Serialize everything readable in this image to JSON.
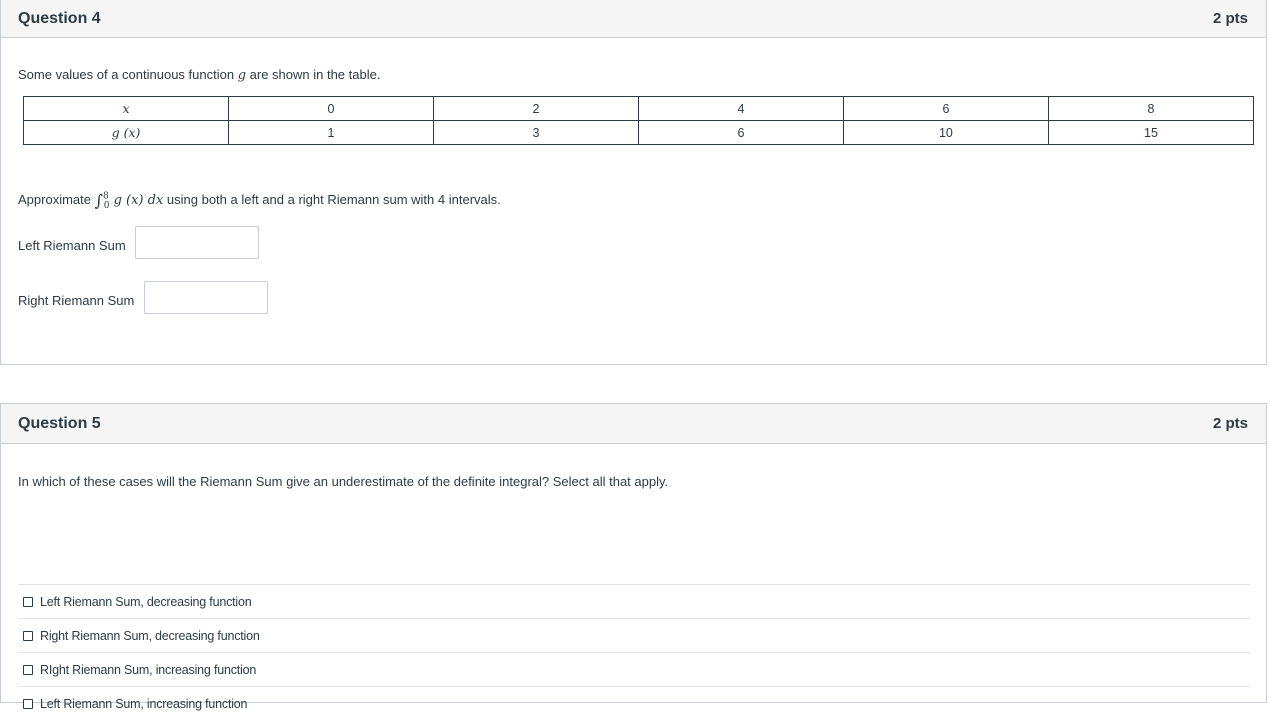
{
  "question4": {
    "title": "Question 4",
    "points": "2 pts",
    "intro_prefix": "Some values of a continuous function ",
    "intro_var": "g",
    "intro_suffix": " are shown in the table.",
    "table": {
      "row_header_x": "x",
      "row_header_g": "g (x)",
      "x_values": [
        "0",
        "2",
        "4",
        "6",
        "8"
      ],
      "g_values": [
        "1",
        "3",
        "6",
        "10",
        "15"
      ]
    },
    "prompt_prefix": "Approximate",
    "integral": {
      "lower": "0",
      "upper": "8",
      "integrand": "g (x) dx"
    },
    "prompt_suffix": "using both a left and a right Riemann sum with 4 intervals.",
    "left_label": "Left Riemann Sum",
    "left_value": "",
    "right_label": "Right Riemann Sum",
    "right_value": ""
  },
  "question5": {
    "title": "Question 5",
    "points": "2 pts",
    "prompt": "In which of these cases will the Riemann Sum give an underestimate of the definite integral? Select all that apply.",
    "options": [
      {
        "label": "Left Riemann Sum, decreasing function",
        "checked": false
      },
      {
        "label": "Right Riemann Sum, decreasing function",
        "checked": false
      },
      {
        "label": "RIght Riemann Sum, increasing function",
        "checked": false
      },
      {
        "label": "Left Riemann Sum, increasing function",
        "checked": false
      }
    ]
  }
}
